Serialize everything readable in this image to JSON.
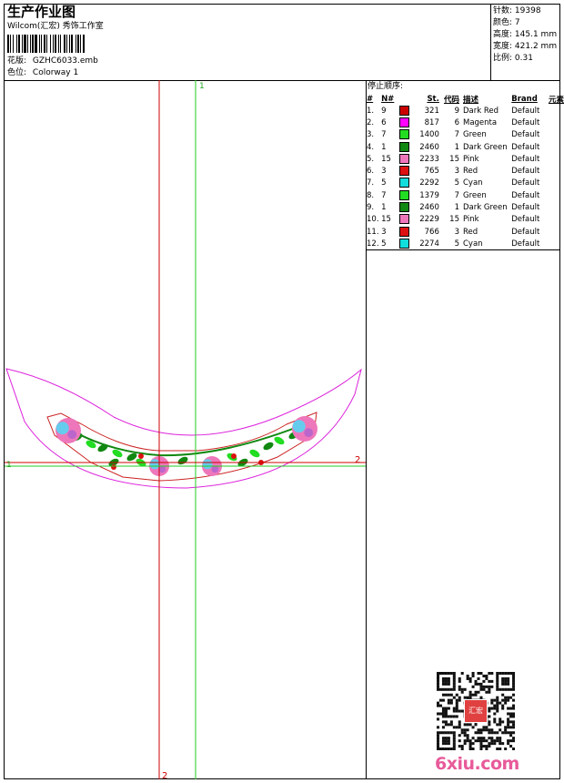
{
  "header": {
    "title": "生产作业图",
    "company": "Wilcom(汇宏) 秀饰工作室",
    "design_label": "花版:",
    "design_file": "GZHC6033.emb",
    "colorway_label": "色位:",
    "colorway": "Colorway 1"
  },
  "stats": [
    {
      "label": "针数:",
      "value": "19398"
    },
    {
      "label": "颜色:",
      "value": "7"
    },
    {
      "label": "高度:",
      "value": "145.1 mm"
    },
    {
      "label": "宽度:",
      "value": "421.2 mm"
    },
    {
      "label": "比例:",
      "value": "0.31"
    }
  ],
  "stop_sequence": {
    "label": "停止顺序:",
    "columns": [
      "#",
      "N#",
      "St.",
      "代码",
      "描述",
      "Brand",
      "元素"
    ],
    "rows": [
      {
        "no": "1.",
        "n": "9",
        "color": "#cc0000",
        "st": "321",
        "code": "9",
        "desc": "Dark Red",
        "brand": "Default"
      },
      {
        "no": "2.",
        "n": "6",
        "color": "#ff00ff",
        "st": "817",
        "code": "6",
        "desc": "Magenta",
        "brand": "Default"
      },
      {
        "no": "3.",
        "n": "7",
        "color": "#22dd22",
        "st": "1400",
        "code": "7",
        "desc": "Green",
        "brand": "Default"
      },
      {
        "no": "4.",
        "n": "1",
        "color": "#118811",
        "st": "2460",
        "code": "1",
        "desc": "Dark Green",
        "brand": "Default"
      },
      {
        "no": "5.",
        "n": "15",
        "color": "#ee77bb",
        "st": "2233",
        "code": "15",
        "desc": "Pink",
        "brand": "Default"
      },
      {
        "no": "6.",
        "n": "3",
        "color": "#dd1111",
        "st": "765",
        "code": "3",
        "desc": "Red",
        "brand": "Default"
      },
      {
        "no": "7.",
        "n": "5",
        "color": "#11dddd",
        "st": "2292",
        "code": "5",
        "desc": "Cyan",
        "brand": "Default"
      },
      {
        "no": "8.",
        "n": "7",
        "color": "#22dd22",
        "st": "1379",
        "code": "7",
        "desc": "Green",
        "brand": "Default"
      },
      {
        "no": "9.",
        "n": "1",
        "color": "#118811",
        "st": "2460",
        "code": "1",
        "desc": "Dark Green",
        "brand": "Default"
      },
      {
        "no": "10.",
        "n": "15",
        "color": "#ee77bb",
        "st": "2229",
        "code": "15",
        "desc": "Pink",
        "brand": "Default"
      },
      {
        "no": "11.",
        "n": "3",
        "color": "#dd1111",
        "st": "766",
        "code": "3",
        "desc": "Red",
        "brand": "Default"
      },
      {
        "no": "12.",
        "n": "5",
        "color": "#11dddd",
        "st": "2274",
        "code": "5",
        "desc": "Cyan",
        "brand": "Default"
      }
    ]
  },
  "guides": {
    "top_1": "1",
    "right_2": "2",
    "left_1": "1",
    "bottom_2": "2"
  },
  "colors": {
    "guide_green": "#22cc22",
    "guide_red": "#cc0000",
    "outline": "#dd22dd"
  },
  "watermark": {
    "text": "6xiu.com",
    "seal_text": "汇宏"
  }
}
